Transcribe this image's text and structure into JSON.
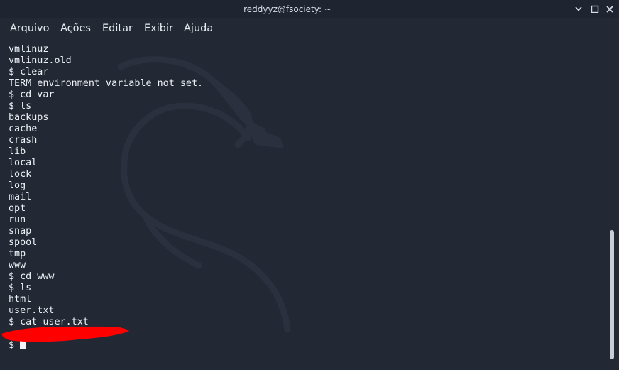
{
  "window": {
    "title": "reddyyz@fsociety: ~",
    "buttons": {
      "minimize_icon": "minimize-icon",
      "maximize_icon": "maximize-icon",
      "close_icon": "close-icon"
    }
  },
  "menu": {
    "items": [
      "Arquivo",
      "Ações",
      "Editar",
      "Exibir",
      "Ajuda"
    ]
  },
  "terminal": {
    "lines": [
      "vmlinuz",
      "vmlinuz.old",
      "$ clear",
      "TERM environment variable not set.",
      "$ cd var",
      "$ ls",
      "backups",
      "cache",
      "crash",
      "lib",
      "local",
      "lock",
      "log",
      "mail",
      "opt",
      "run",
      "snap",
      "spool",
      "tmp",
      "www",
      "$ cd www",
      "$ ls",
      "html",
      "user.txt",
      "$ cat user.txt",
      "",
      "$ "
    ],
    "prompt": "$",
    "redaction_color": "#ff0000"
  },
  "colors": {
    "background": "#222834",
    "titlebar": "#1f2530",
    "text": "#eef1f5",
    "scrollbar": "#c9ced6"
  }
}
